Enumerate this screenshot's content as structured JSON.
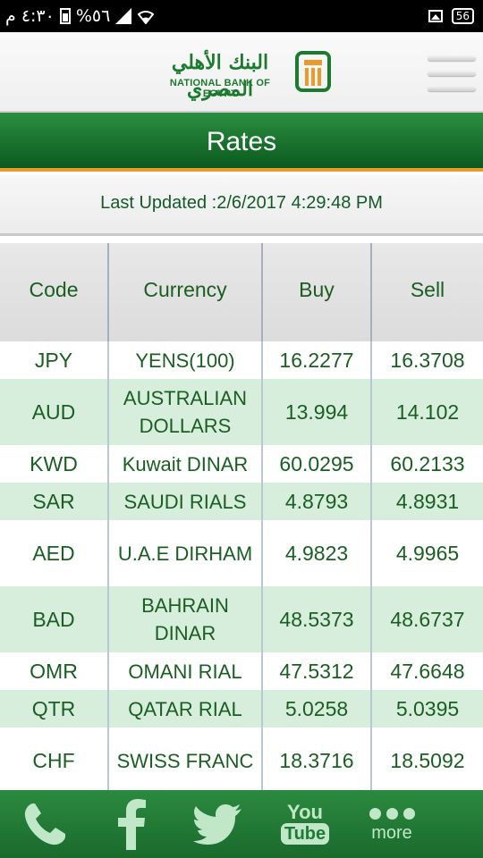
{
  "status_bar": {
    "time": "٤:٣٠ م",
    "battery_percent": "%٥٦",
    "battery_badge": "56"
  },
  "header": {
    "bank_name_arabic": "البنك الأهلي المصري",
    "bank_name_english": "NATIONAL BANK OF EGYPT"
  },
  "page": {
    "title": "Rates",
    "last_updated": "Last Updated :2/6/2017 4:29:48 PM"
  },
  "table": {
    "headers": [
      "Code",
      "Currency",
      "Buy",
      "Sell"
    ],
    "rows": [
      {
        "code": "JPY",
        "currency": "YENS(100)",
        "buy": "16.2277",
        "sell": "16.3708"
      },
      {
        "code": "AUD",
        "currency": "AUSTRALIAN DOLLARS",
        "buy": "13.994",
        "sell": "14.102"
      },
      {
        "code": "KWD",
        "currency": "Kuwait DINAR",
        "buy": "60.0295",
        "sell": "60.2133"
      },
      {
        "code": "SAR",
        "currency": "SAUDI RIALS",
        "buy": "4.8793",
        "sell": "4.8931"
      },
      {
        "code": "AED",
        "currency": "U.A.E DIRHAM",
        "buy": "4.9823",
        "sell": "4.9965"
      },
      {
        "code": "BAD",
        "currency": "BAHRAIN DINAR",
        "buy": "48.5373",
        "sell": "48.6737"
      },
      {
        "code": "OMR",
        "currency": "OMANI RIAL",
        "buy": "47.5312",
        "sell": "47.6648"
      },
      {
        "code": "QTR",
        "currency": "QATAR RIAL",
        "buy": "5.0258",
        "sell": "5.0395"
      },
      {
        "code": "CHF",
        "currency": "SWISS FRANC",
        "buy": "18.3716",
        "sell": "18.5092"
      }
    ]
  },
  "bottom_nav": {
    "items": [
      {
        "icon": "phone-icon"
      },
      {
        "icon": "facebook-icon"
      },
      {
        "icon": "twitter-icon"
      },
      {
        "icon": "youtube-icon",
        "you": "You",
        "tube": "Tube"
      },
      {
        "icon": "more-icon",
        "label": "more"
      }
    ]
  },
  "colors": {
    "brand_green": "#1c7a2e",
    "title_bar_green": "#0b5a1e",
    "accent_orange": "#e89a2c",
    "row_highlight": "#d7eedd"
  }
}
